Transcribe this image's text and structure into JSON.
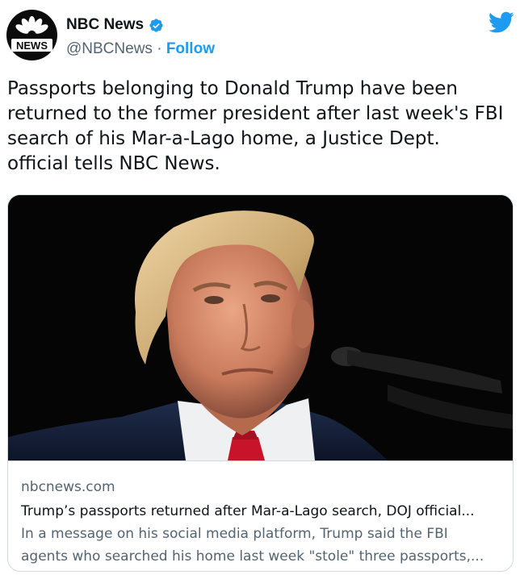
{
  "author": {
    "name": "NBC News",
    "handle": "@NBCNews",
    "separator": " · ",
    "follow_label": "Follow",
    "avatar_text": "NEWS",
    "verified": true
  },
  "icons": {
    "avatar": "nbc-peacock-logo",
    "verified": "verified-badge-icon",
    "brand": "twitter-bird-icon"
  },
  "colors": {
    "accent": "#1d9bf0",
    "text": "#0f1419",
    "secondary": "#536471",
    "border": "#cfd9de"
  },
  "tweet": {
    "text": "Passports belonging to Donald Trump have been\nreturned to the former president after last week's FBI\nsearch of his Mar-a-Lago home, a Justice Dept.\nofficial tells NBC News."
  },
  "card": {
    "domain": "nbcnews.com",
    "title": "Trump’s passports returned after Mar-a-Lago search, DOJ official...",
    "description": "In a message on his social media platform, Trump said the FBI\nagents who searched his home last week \"stole\" three passports,..."
  }
}
